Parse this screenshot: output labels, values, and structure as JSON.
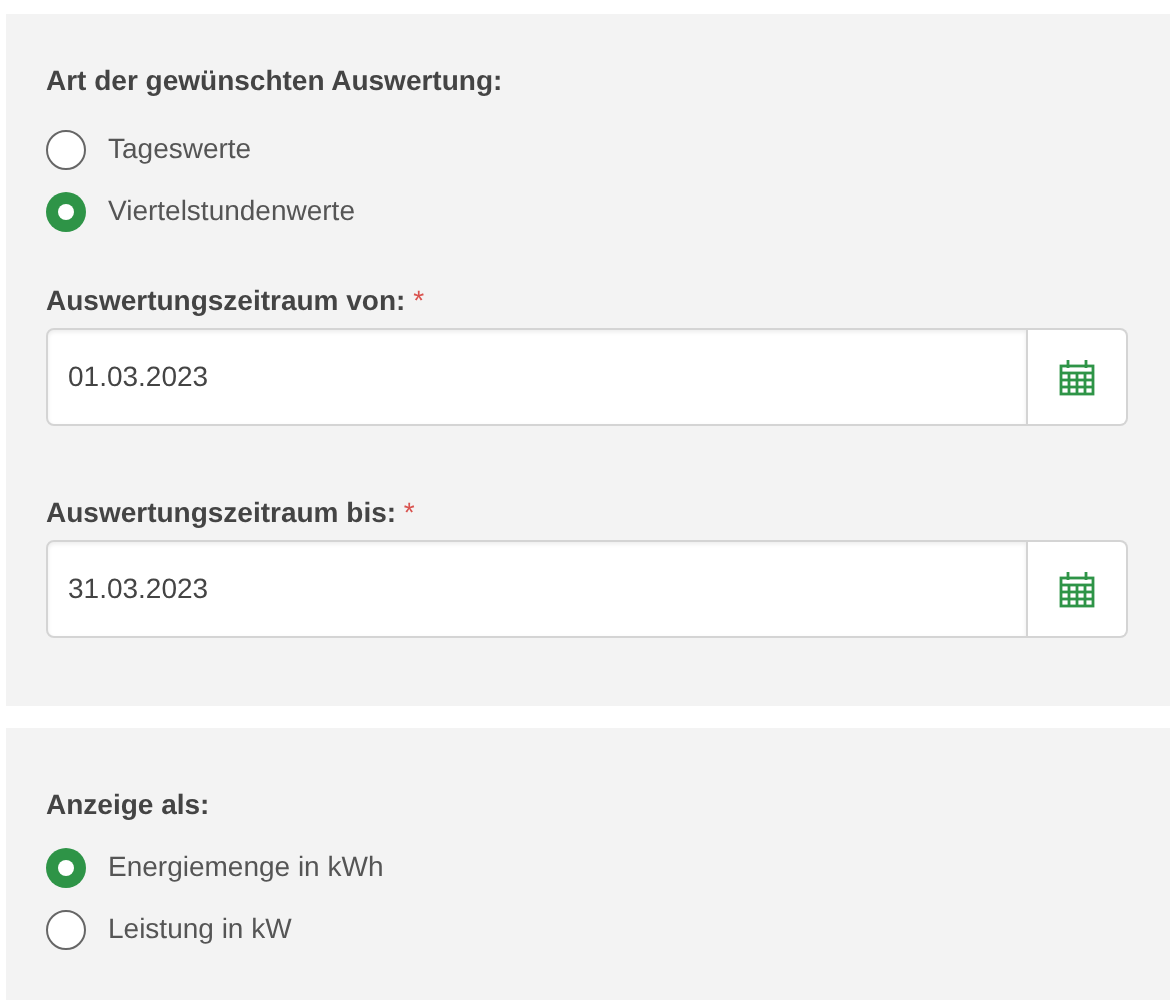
{
  "evaluation_type": {
    "label": "Art der gewünschten Auswertung:",
    "options": [
      {
        "label": "Tageswerte",
        "selected": false
      },
      {
        "label": "Viertelstundenwerte",
        "selected": true
      }
    ]
  },
  "date_fields": [
    {
      "label": "Auswertungszeitraum von:",
      "required_mark": "*",
      "value": "01.03.2023"
    },
    {
      "label": "Auswertungszeitraum bis:",
      "required_mark": "*",
      "value": "31.03.2023"
    }
  ],
  "display_as": {
    "label": "Anzeige als:",
    "options": [
      {
        "label": "Energiemenge in kWh",
        "selected": true
      },
      {
        "label": "Leistung in kW",
        "selected": false
      }
    ]
  }
}
